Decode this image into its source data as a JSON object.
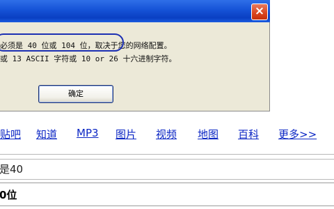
{
  "dialog": {
    "close_icon": "×",
    "message_line1": "必须是 40 位或 104 位，取决于您的网络配置。",
    "message_line2": "或 13 ASCII 字符或 10 or 26 十六进制字符。",
    "ok_label": "确定"
  },
  "nav": {
    "links": [
      "贴吧",
      "知道",
      "MP3",
      "图片",
      "视频",
      "地图",
      "百科",
      "更多>>"
    ]
  },
  "search": {
    "value": "是40"
  },
  "suggestions": [
    "0位"
  ]
}
